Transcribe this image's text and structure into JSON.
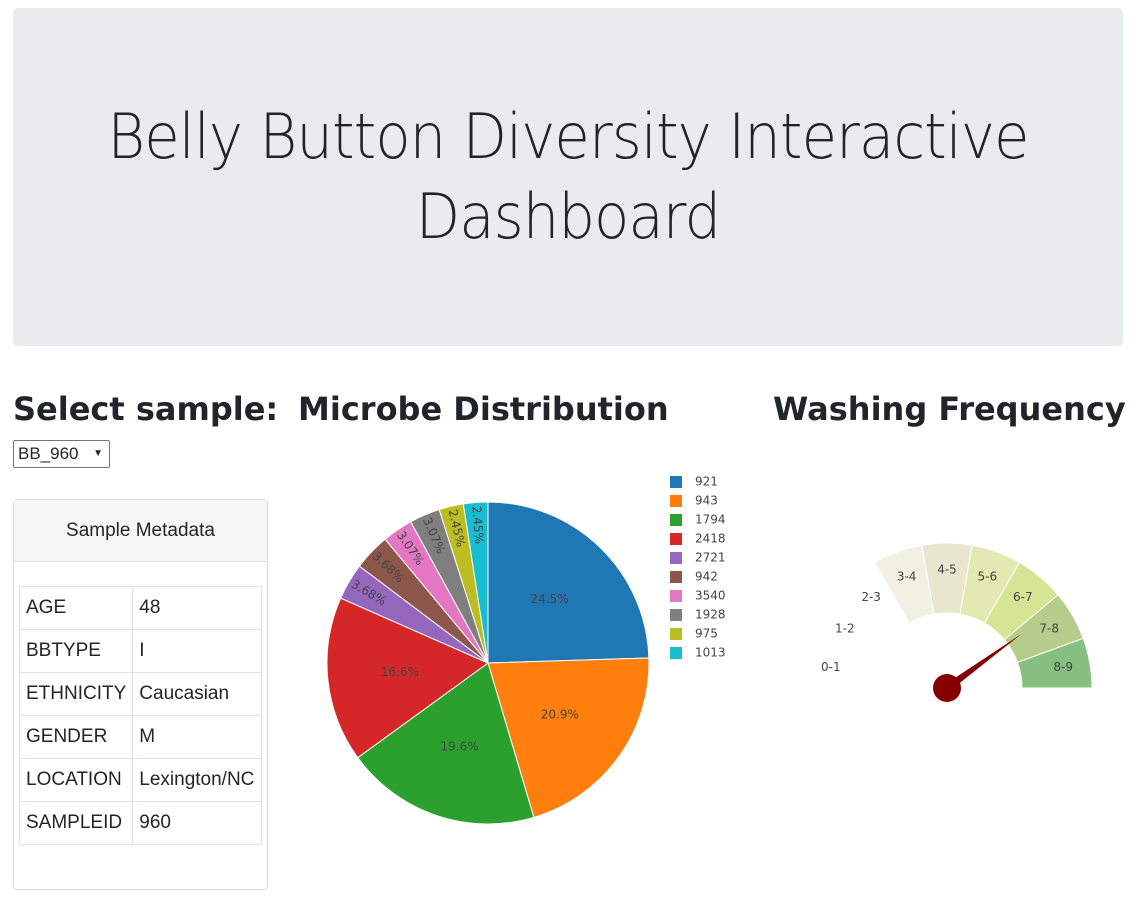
{
  "header": {
    "title": "Belly Button Diversity Interactive Dashboard"
  },
  "select_section": {
    "heading": "Select sample:",
    "selected": "BB_960"
  },
  "metadata": {
    "title": "Sample Metadata",
    "rows": [
      {
        "key": "AGE",
        "value": "48"
      },
      {
        "key": "BBTYPE",
        "value": "I"
      },
      {
        "key": "ETHNICITY",
        "value": "Caucasian"
      },
      {
        "key": "GENDER",
        "value": "M"
      },
      {
        "key": "LOCATION",
        "value": "Lexington/NC"
      },
      {
        "key": "SAMPLEID",
        "value": "960"
      }
    ]
  },
  "pie_section": {
    "heading": "Microbe Distribution"
  },
  "gauge_section": {
    "heading": "Washing Frequency"
  },
  "chart_data": [
    {
      "type": "pie",
      "labels": [
        "921",
        "943",
        "1794",
        "2418",
        "2721",
        "942",
        "3540",
        "1928",
        "975",
        "1013"
      ],
      "values": [
        24.5,
        20.9,
        19.6,
        16.6,
        3.68,
        3.68,
        3.07,
        3.07,
        2.45,
        2.45
      ],
      "value_labels": [
        "24.5%",
        "20.9%",
        "19.6%",
        "16.6%",
        "3.68%",
        "3.68%",
        "3.07%",
        "3.07%",
        "2.45%",
        "2.45%"
      ],
      "colors": [
        "#1f77b4",
        "#ff7f0e",
        "#2ca02c",
        "#d62728",
        "#9467bd",
        "#8c564b",
        "#e377c2",
        "#7f7f7f",
        "#bcbd22",
        "#17becf"
      ],
      "legend": "right"
    },
    {
      "type": "gauge",
      "segments": [
        "0-1",
        "1-2",
        "2-3",
        "3-4",
        "4-5",
        "5-6",
        "6-7",
        "7-8",
        "8-9"
      ],
      "segment_colors": [
        "#ffffff",
        "#ffffff",
        "#ffffff",
        "#f2efe3",
        "#e8e6cf",
        "#e3e9b2",
        "#d6e595",
        "#b5cc8b",
        "#86bf7f"
      ],
      "value": 7.2,
      "range": [
        0,
        9
      ],
      "needle_color": "#850000"
    }
  ]
}
